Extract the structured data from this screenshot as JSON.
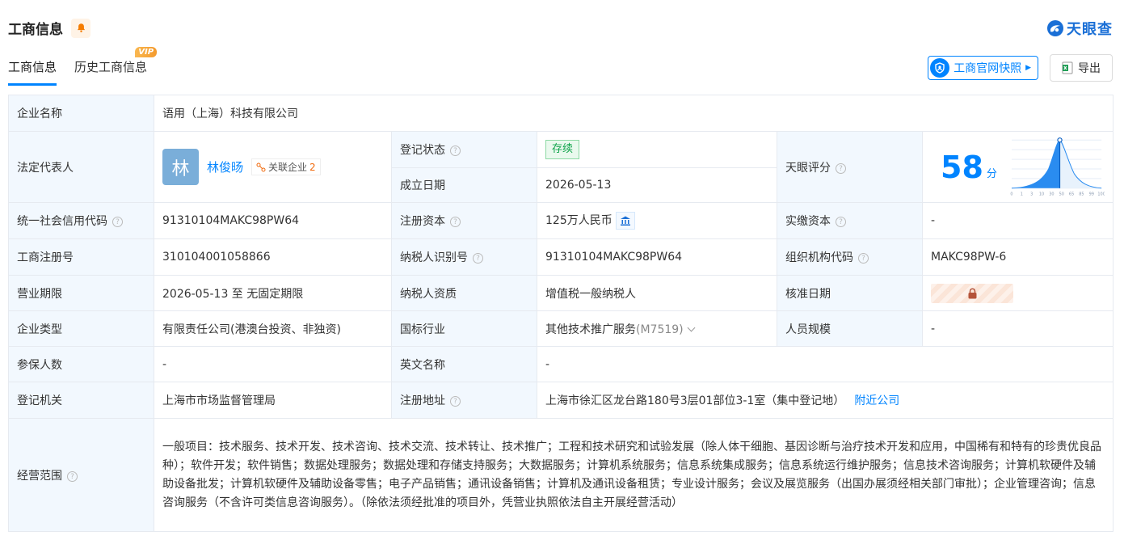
{
  "header": {
    "title": "工商信息",
    "brand": "天眼查"
  },
  "tabs": [
    {
      "label": "工商信息"
    },
    {
      "label": "历史工商信息",
      "badge": "VIP"
    }
  ],
  "actions": {
    "snapshot": "工商官网快照",
    "export": "导出"
  },
  "company": {
    "name_label": "企业名称",
    "name": "语用（上海）科技有限公司",
    "legal_label": "法定代表人",
    "legal_avatar": "林",
    "legal_name": "林俊旸",
    "related_label": "关联企业",
    "related_count": "2",
    "status_label": "登记状态",
    "status": "存续",
    "founded_label": "成立日期",
    "founded": "2026-05-13",
    "score_label": "天眼评分",
    "score": "58",
    "score_unit": "分",
    "score_axis": [
      "0",
      "1",
      "3",
      "10",
      "30",
      "50",
      "65",
      "85",
      "99",
      "100"
    ],
    "credit_label": "统一社会信用代码",
    "credit": "91310104MAKC98PW64",
    "capital_label": "注册资本",
    "capital": "125万人民币",
    "paid_label": "实缴资本",
    "paid": "-",
    "reg_no_label": "工商注册号",
    "reg_no": "310104001058866",
    "tax_label": "纳税人识别号",
    "tax": "91310104MAKC98PW64",
    "org_label": "组织机构代码",
    "org": "MAKC98PW-6",
    "term_label": "营业期限",
    "term": "2026-05-13 至 无固定期限",
    "taxpayer_label": "纳税人资质",
    "taxpayer": "增值税一般纳税人",
    "approve_label": "核准日期",
    "type_label": "企业类型",
    "type": "有限责任公司(港澳台投资、非独资)",
    "industry_label": "国标行业",
    "industry": "其他技术推广服务",
    "industry_code": "(M7519)",
    "staff_label": "人员规模",
    "staff": "-",
    "insured_label": "参保人数",
    "insured": "-",
    "en_label": "英文名称",
    "en": "-",
    "authority_label": "登记机关",
    "authority": "上海市市场监督管理局",
    "address_label": "注册地址",
    "address": "上海市徐汇区龙台路180号3层01部位3-1室（集中登记地）",
    "nearby": "附近公司",
    "scope_label": "经营范围",
    "scope": "一般项目：技术服务、技术开发、技术咨询、技术交流、技术转让、技术推广；工程和技术研究和试验发展（除人体干细胞、基因诊断与治疗技术开发和应用，中国稀有和特有的珍贵优良品种）；软件开发；软件销售；数据处理服务；数据处理和存储支持服务；大数据服务；计算机系统服务；信息系统集成服务；信息系统运行维护服务；信息技术咨询服务；计算机软硬件及辅助设备批发；计算机软硬件及辅助设备零售；电子产品销售；通讯设备销售；计算机及通讯设备租赁；专业设计服务；会议及展览服务（出国办展须经相关部门审批）；企业管理咨询；信息咨询服务（不含许可类信息咨询服务）。（除依法须经批准的项目外，凭营业执照依法自主开展经营活动）"
  },
  "colors": {
    "accent": "#0084ff",
    "label_bg": "#f2f8fe",
    "status_green": "#0ea34a"
  }
}
